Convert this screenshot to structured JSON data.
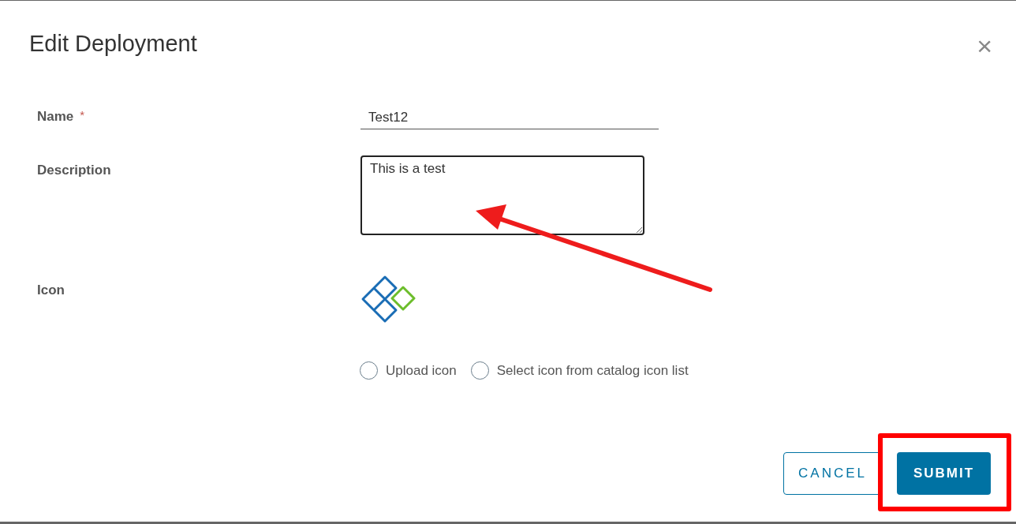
{
  "dialog": {
    "title": "Edit Deployment",
    "close": "×"
  },
  "fields": [
    {
      "kind": "text",
      "label": "Name",
      "required_mark": "*",
      "value": "Test12"
    },
    {
      "kind": "textarea",
      "label": "Description",
      "value": "This is a test"
    },
    {
      "kind": "icon",
      "label": "Icon",
      "options": [
        {
          "label": "Upload icon",
          "selected": false
        },
        {
          "label": "Select icon from catalog icon list",
          "selected": false
        }
      ]
    }
  ],
  "buttons": [
    {
      "label": "CANCEL",
      "kind": "secondary"
    },
    {
      "label": "SUBMIT",
      "kind": "primary"
    }
  ]
}
